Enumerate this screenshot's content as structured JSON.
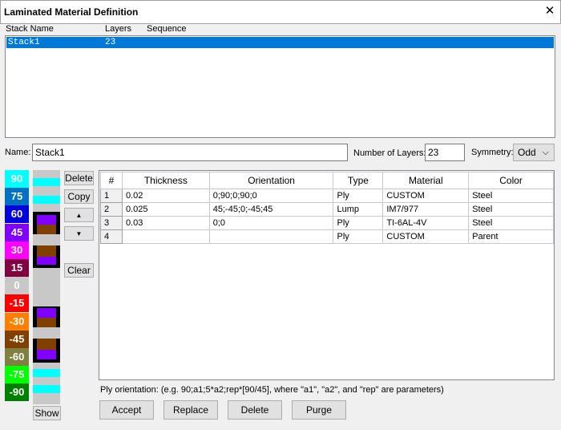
{
  "window": {
    "title": "Laminated Material Definition",
    "close_glyph": "✕"
  },
  "stack_list": {
    "headers": [
      "Stack Name",
      "Layers",
      "Sequence"
    ],
    "rows": [
      {
        "name": "Stack1",
        "layers": "23",
        "sequence": ""
      }
    ]
  },
  "form": {
    "name_label": "Name:",
    "name_value": "Stack1",
    "layers_label": "Number of Layers:",
    "layers_value": "23",
    "symmetry_label": "Symmetry:",
    "symmetry_value": "Odd"
  },
  "legend": [
    {
      "label": "90",
      "color": "#00ffff"
    },
    {
      "label": "75",
      "color": "#0070c0"
    },
    {
      "label": "60",
      "color": "#0000dd"
    },
    {
      "label": "45",
      "color": "#8000ff"
    },
    {
      "label": "30",
      "color": "#ff00ff"
    },
    {
      "label": "15",
      "color": "#800040"
    },
    {
      "label": "0",
      "color": "#c8c8c8"
    },
    {
      "label": "-15",
      "color": "#ff0000"
    },
    {
      "label": "-30",
      "color": "#ff8000"
    },
    {
      "label": "-45",
      "color": "#804000"
    },
    {
      "label": "-60",
      "color": "#808040"
    },
    {
      "label": "-75",
      "color": "#00ff00"
    },
    {
      "label": "-90",
      "color": "#008000"
    }
  ],
  "sequence_colors": {
    "cyan": "#00ffff",
    "grey": "#c8c8c8",
    "black": "#000000",
    "violet": "#8000ff",
    "brown": "#804000"
  },
  "side_buttons": {
    "delete": "Delete",
    "copy": "Copy",
    "up_icon": "▲",
    "down_icon": "▼",
    "clear": "Clear",
    "show": "Show"
  },
  "grid": {
    "columns": [
      "#",
      "Thickness",
      "Orientation",
      "Type",
      "Material",
      "Color"
    ],
    "rows": [
      {
        "num": "1",
        "thickness": "0.02",
        "orientation": "0;90;0;90;0",
        "type": "Ply",
        "material": "CUSTOM",
        "color": "Steel"
      },
      {
        "num": "2",
        "thickness": "0.025",
        "orientation": "45;-45;0;-45;45",
        "type": "Lump",
        "material": "IM7/977",
        "color": "Steel"
      },
      {
        "num": "3",
        "thickness": "0.03",
        "orientation": "0;0",
        "type": "Ply",
        "material": "TI-6AL-4V",
        "color": "Steel"
      },
      {
        "num": "4",
        "thickness": "",
        "orientation": "",
        "type": "Ply",
        "material": "CUSTOM",
        "color": "Parent"
      }
    ]
  },
  "hint_text": "Ply orientation: (e.g. 90;a1;5*a2;rep*[90/45], where \"a1\", \"a2\", and \"rep\" are parameters)",
  "bottom_buttons": {
    "accept": "Accept",
    "replace": "Replace",
    "delete": "Delete",
    "purge": "Purge"
  }
}
